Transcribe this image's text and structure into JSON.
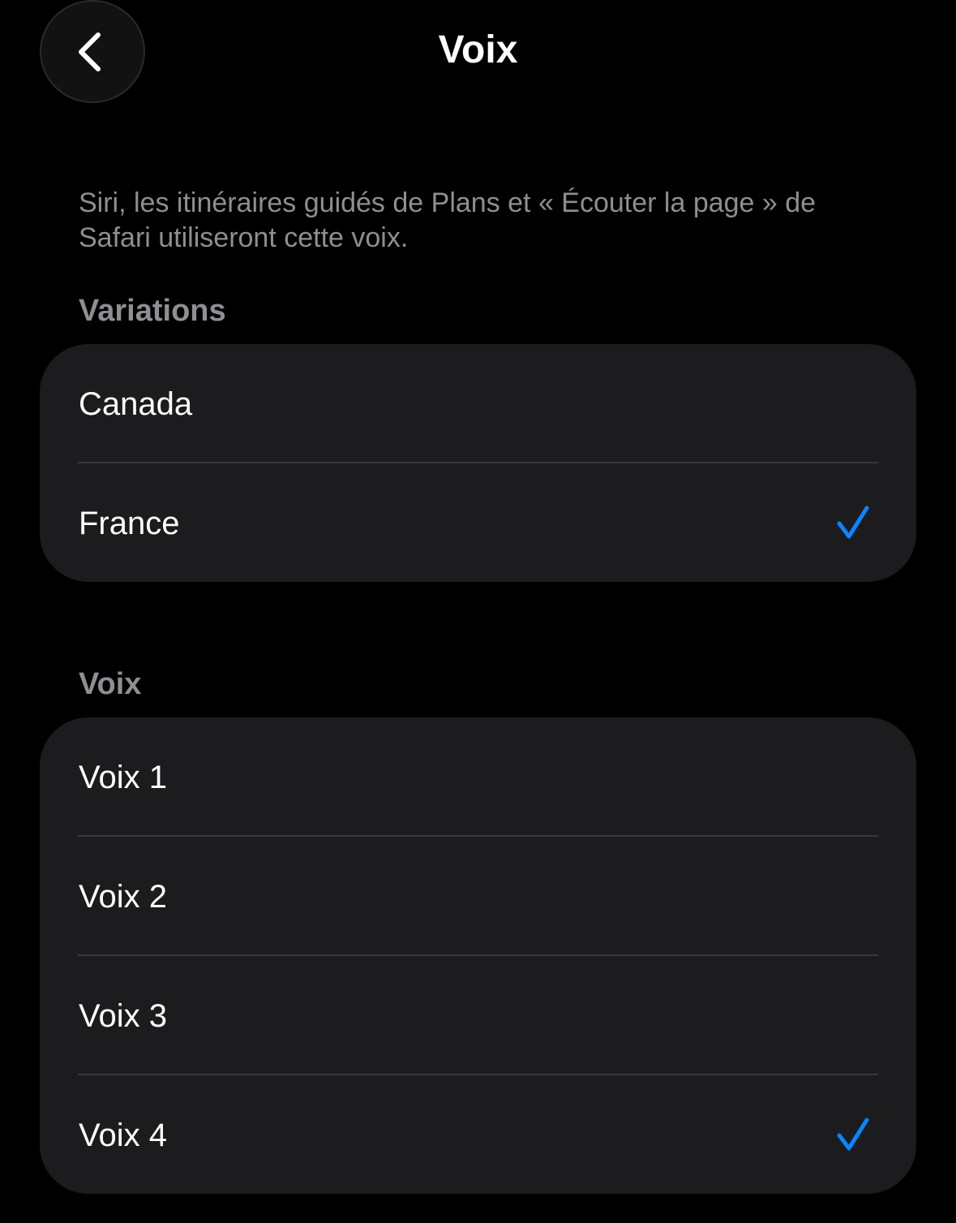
{
  "header": {
    "back_icon": "chevron-left-icon",
    "title": "Voix"
  },
  "description": "Siri, les itinéraires guidés de Plans et « Écouter la page » de Safari utiliseront cette voix.",
  "sections": {
    "variations": {
      "title": "Variations",
      "items": [
        {
          "label": "Canada",
          "selected": false
        },
        {
          "label": "France",
          "selected": true
        }
      ]
    },
    "voices": {
      "title": "Voix",
      "items": [
        {
          "label": "Voix 1",
          "selected": false
        },
        {
          "label": "Voix 2",
          "selected": false
        },
        {
          "label": "Voix 3",
          "selected": false
        },
        {
          "label": "Voix 4",
          "selected": true
        }
      ]
    }
  },
  "colors": {
    "background": "#000000",
    "group_background": "#1c1c1e",
    "secondary_text": "#8e8e93",
    "accent": "#0a84ff",
    "separator": "#38383a"
  },
  "icons": {
    "checkmark": "checkmark-icon"
  }
}
